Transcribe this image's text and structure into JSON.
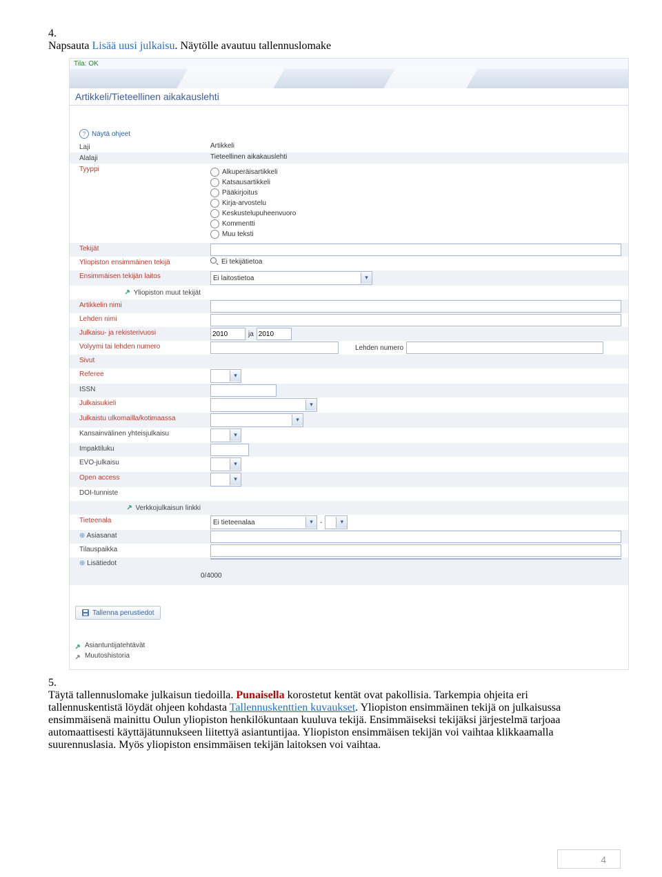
{
  "step4": {
    "number": "4.",
    "pre": "Napsauta ",
    "link": "Lisää uusi julkaisu",
    "post": ". Näytölle avautuu tallennuslomake"
  },
  "form": {
    "statusLabel": "Tila:",
    "statusValue": "OK",
    "title": "Artikkeli/Tieteellinen aikakauslehti",
    "helpLink": "Näytä ohjeet",
    "fields": {
      "laji": {
        "label": "Laji",
        "value": "Artikkeli"
      },
      "alalaji": {
        "label": "Alalaji",
        "value": "Tieteellinen aikakauslehti"
      },
      "tyyppi": {
        "label": "Tyyppi",
        "options": [
          "Alkuperäisartikkeli",
          "Katsausartikkeli",
          "Pääkirjoitus",
          "Kirja-arvostelu",
          "Keskustelupuheenvuoro",
          "Kommentti",
          "Muu teksti"
        ]
      },
      "tekijat": {
        "label": "Tekijät"
      },
      "ensimmainenTekija": {
        "label": "Yliopiston ensimmäinen tekijä",
        "value": "Ei tekijätietoa"
      },
      "laitos": {
        "label": "Ensimmäisen tekijän laitos",
        "value": "Ei laitostietoa"
      },
      "muutTekijat": {
        "label": "Yliopiston muut tekijät"
      },
      "artikkelinNimi": {
        "label": "Artikkelin nimi"
      },
      "lehdenNimi": {
        "label": "Lehden nimi"
      },
      "vuosi": {
        "label": "Julkaisu- ja rekisterivuosi",
        "value1": "2010",
        "ja": "ja",
        "value2": "2010"
      },
      "volyymi": {
        "label": "Volyymi tai lehden numero",
        "label2": "Lehden numero"
      },
      "sivut": {
        "label": "Sivut"
      },
      "referee": {
        "label": "Referee"
      },
      "issn": {
        "label": "ISSN"
      },
      "julkaisukieli": {
        "label": "Julkaisukieli"
      },
      "ulkomailla": {
        "label": "Julkaistu ulkomailla/kotimaassa"
      },
      "kansainvalinen": {
        "label": "Kansainvälinen yhteisjulkaisu"
      },
      "impaktiluku": {
        "label": "Impaktiluku"
      },
      "evo": {
        "label": "EVO-julkaisu"
      },
      "openAccess": {
        "label": "Open access"
      },
      "doi": {
        "label": "DOI-tunniste"
      },
      "verkkolinkki": {
        "label": "Verkkojulkaisun linkki"
      },
      "tieteenala": {
        "label": "Tieteenala",
        "value": "Ei tieteenalaa",
        "dash": "-"
      },
      "asiasanat": {
        "label": "Asiasanat"
      },
      "tilauspaikka": {
        "label": "Tilauspaikka"
      },
      "lisatiedot": {
        "label": "Lisätiedot",
        "counter": "0/4000"
      }
    },
    "saveButton": "Tallenna perustiedot",
    "bottomLinks": [
      "Asiantuntijatehtävät",
      "Muutoshistoria"
    ]
  },
  "step5": {
    "number": "5.",
    "line1a": "Täytä tallennuslomake julkaisun tiedoilla. ",
    "red": "Punaisella",
    "line1b": " korostetut kentät ovat pakollisia. Tarkempia",
    "line2a": "ohjeita eri tallennuskentistä löydät ohjeen kohdasta ",
    "link": "Tallennuskenttien kuvaukset",
    "line2b": ".",
    "line3": "Yliopiston ensimmäinen tekijä on julkaisussa ensimmäisenä mainittu Oulun yliopiston henkilökuntaan kuuluva tekijä. Ensimmäiseksi tekijäksi järjestelmä tarjoaa automaattisesti käyttäjätunnukseen liitettyä asiantuntijaa. Yliopiston ensimmäisen tekijän voi vaihtaa klikkaamalla suurennuslasia. Myös yliopiston ensimmäisen tekijän laitoksen voi vaihtaa."
  },
  "pageNumber": "4"
}
